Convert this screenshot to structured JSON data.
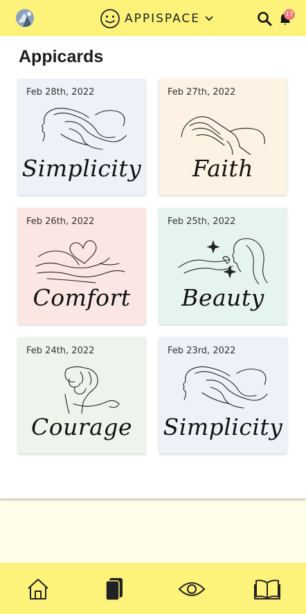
{
  "header": {
    "app_name": "APPISPACE",
    "notification_count": "17"
  },
  "page": {
    "title": "Appicards"
  },
  "cards": [
    {
      "date": "Feb 28th, 2022",
      "word": "Simplicity",
      "bg": "#eef1f7",
      "art": "face-waves"
    },
    {
      "date": "Feb 27th, 2022",
      "word": "Faith",
      "bg": "#fdf2e3",
      "art": "praying-hands"
    },
    {
      "date": "Feb 26th, 2022",
      "word": "Comfort",
      "bg": "#fbe6e4",
      "art": "heart-hug"
    },
    {
      "date": "Feb 25th, 2022",
      "word": "Beauty",
      "bg": "#e6f4f1",
      "art": "woman-sparkles"
    },
    {
      "date": "Feb 24th, 2022",
      "word": "Courage",
      "bg": "#eef4ec",
      "art": "raised-fist"
    },
    {
      "date": "Feb 23rd, 2022",
      "word": "Simplicity",
      "bg": "#eef1f7",
      "art": "face-waves"
    }
  ],
  "nav": [
    "home-icon",
    "cards-icon",
    "eye-icon",
    "book-icon"
  ],
  "colors": {
    "header_bg": "#fdf27a",
    "badge": "#ef7a7a",
    "footer_area": "#fefde8"
  }
}
